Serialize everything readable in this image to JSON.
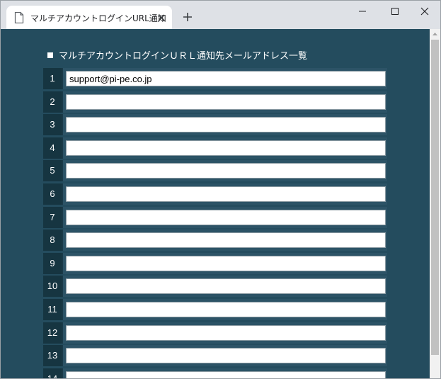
{
  "browser": {
    "tab_title": "マルチアカウントログインURL通知"
  },
  "page": {
    "heading": "マルチアカウントログインＵＲＬ通知先メールアドレス一覧",
    "rows": [
      {
        "num": "1",
        "value": "support@pi-pe.co.jp"
      },
      {
        "num": "2",
        "value": ""
      },
      {
        "num": "3",
        "value": ""
      },
      {
        "num": "4",
        "value": ""
      },
      {
        "num": "5",
        "value": ""
      },
      {
        "num": "6",
        "value": ""
      },
      {
        "num": "7",
        "value": ""
      },
      {
        "num": "8",
        "value": ""
      },
      {
        "num": "9",
        "value": ""
      },
      {
        "num": "10",
        "value": ""
      },
      {
        "num": "11",
        "value": ""
      },
      {
        "num": "12",
        "value": ""
      },
      {
        "num": "13",
        "value": ""
      },
      {
        "num": "14",
        "value": ""
      }
    ]
  },
  "colors": {
    "page_background": "#244c5e",
    "row_number_background": "#163541",
    "row_field_background": "#2c5366"
  },
  "icons": {
    "tab": "document-icon",
    "tab_close": "close-icon",
    "new_tab": "plus-icon",
    "window": [
      "minimize-icon",
      "maximize-icon",
      "close-icon"
    ],
    "scroll": "chevron-up-icon"
  }
}
